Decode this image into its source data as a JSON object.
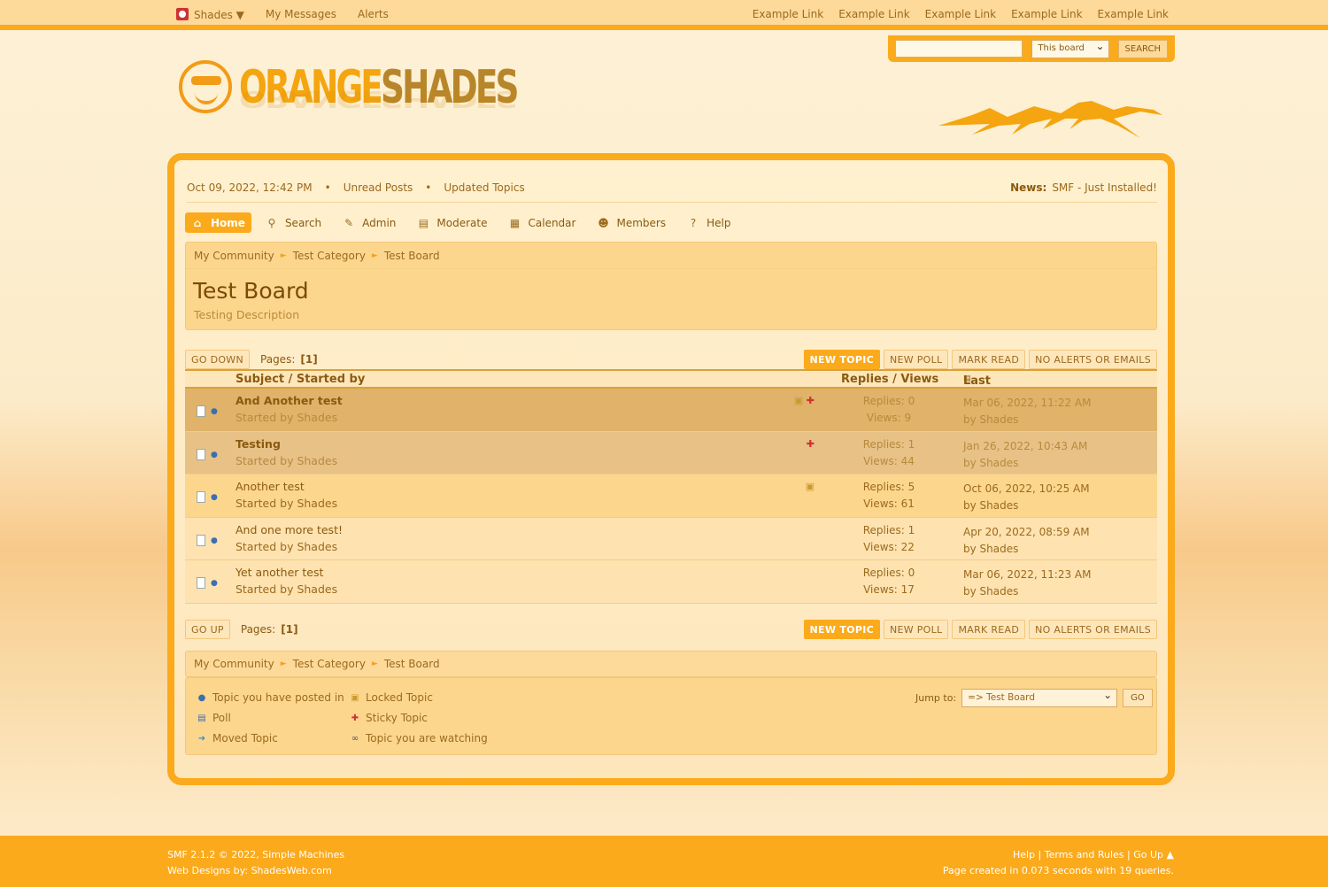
{
  "topbar": {
    "user": "Shades",
    "user_caret": "▼",
    "links_left": [
      "My Messages",
      "Alerts"
    ],
    "links_right": [
      "Example Link",
      "Example Link",
      "Example Link",
      "Example Link",
      "Example Link"
    ]
  },
  "search": {
    "value": "",
    "scope": "This board",
    "button": "SEARCH"
  },
  "logo": {
    "part1": "ORANGE",
    "part2": "SHADES"
  },
  "userline": {
    "date": "Oct 09, 2022, 12:42 PM",
    "bullet": "•",
    "unread": "Unread Posts",
    "updated": "Updated Topics",
    "news_label": "News:",
    "news_text": "SMF - Just Installed!"
  },
  "menu": [
    {
      "label": "Home",
      "icon": "home-icon",
      "active": true
    },
    {
      "label": "Search",
      "icon": "search-icon"
    },
    {
      "label": "Admin",
      "icon": "admin-icon"
    },
    {
      "label": "Moderate",
      "icon": "moderate-icon"
    },
    {
      "label": "Calendar",
      "icon": "calendar-icon"
    },
    {
      "label": "Members",
      "icon": "members-icon"
    },
    {
      "label": "Help",
      "icon": "help-icon"
    }
  ],
  "breadcrumb": [
    "My Community",
    "Test Category",
    "Test Board"
  ],
  "breadcrumb_sep": "►",
  "board": {
    "title": "Test Board",
    "description": "Testing Description"
  },
  "pagination": {
    "go_down": "GO DOWN",
    "go_up": "GO UP",
    "pages_label": "Pages:",
    "pages_value": "[1]"
  },
  "actions": {
    "new_topic": "NEW TOPIC",
    "new_poll": "NEW POLL",
    "mark_read": "MARK READ",
    "notify": "NO ALERTS OR EMAILS"
  },
  "table": {
    "col_subject": "Subject / Started by",
    "col_replies": "Replies / Views",
    "col_last": "Last post"
  },
  "topics": [
    {
      "subject": "And Another test",
      "started": "Started by Shades",
      "replies": "Replies: 0",
      "views": "Views: 9",
      "last_date": "Mar 06, 2022, 11:22 AM",
      "last_by": "by Shades",
      "style": "sticky1",
      "locked": true,
      "sticky": true
    },
    {
      "subject": "Testing",
      "started": "Started by Shades",
      "replies": "Replies: 1",
      "views": "Views: 44",
      "last_date": "Jan 26, 2022, 10:43 AM",
      "last_by": "by Shades",
      "style": "sticky2",
      "locked": false,
      "sticky": true
    },
    {
      "subject": "Another test",
      "started": "Started by Shades",
      "replies": "Replies: 5",
      "views": "Views: 61",
      "last_date": "Oct 06, 2022, 10:25 AM",
      "last_by": "by Shades",
      "style": "locked",
      "locked": true,
      "sticky": false
    },
    {
      "subject": "And one more test!",
      "started": "Started by Shades",
      "replies": "Replies: 1",
      "views": "Views: 22",
      "last_date": "Apr 20, 2022, 08:59 AM",
      "last_by": "by Shades",
      "style": "normal",
      "locked": false,
      "sticky": false
    },
    {
      "subject": "Yet another test",
      "started": "Started by Shades",
      "replies": "Replies: 0",
      "views": "Views: 17",
      "last_date": "Mar 06, 2022, 11:23 AM",
      "last_by": "by Shades",
      "style": "normal",
      "locked": false,
      "sticky": false
    }
  ],
  "legend": {
    "posted": "Topic you have posted in",
    "poll": "Poll",
    "moved": "Moved Topic",
    "locked": "Locked Topic",
    "sticky": "Sticky Topic",
    "watching": "Topic you are watching"
  },
  "jump": {
    "label": "Jump to:",
    "selected": "=> Test Board",
    "go": "GO"
  },
  "footer": {
    "copyright": "SMF 2.1.2 © 2022, Simple Machines",
    "designs": "Web Designs by: ShadesWeb.com",
    "help": "Help",
    "terms": "Terms and Rules",
    "go_up": "Go Up ▲",
    "sep": "|",
    "stats": "Page created in 0.073 seconds with 19 queries."
  },
  "colors": {
    "accent": "#fbaa1c",
    "text": "#8a5a10",
    "panel": "#fdd99a"
  }
}
